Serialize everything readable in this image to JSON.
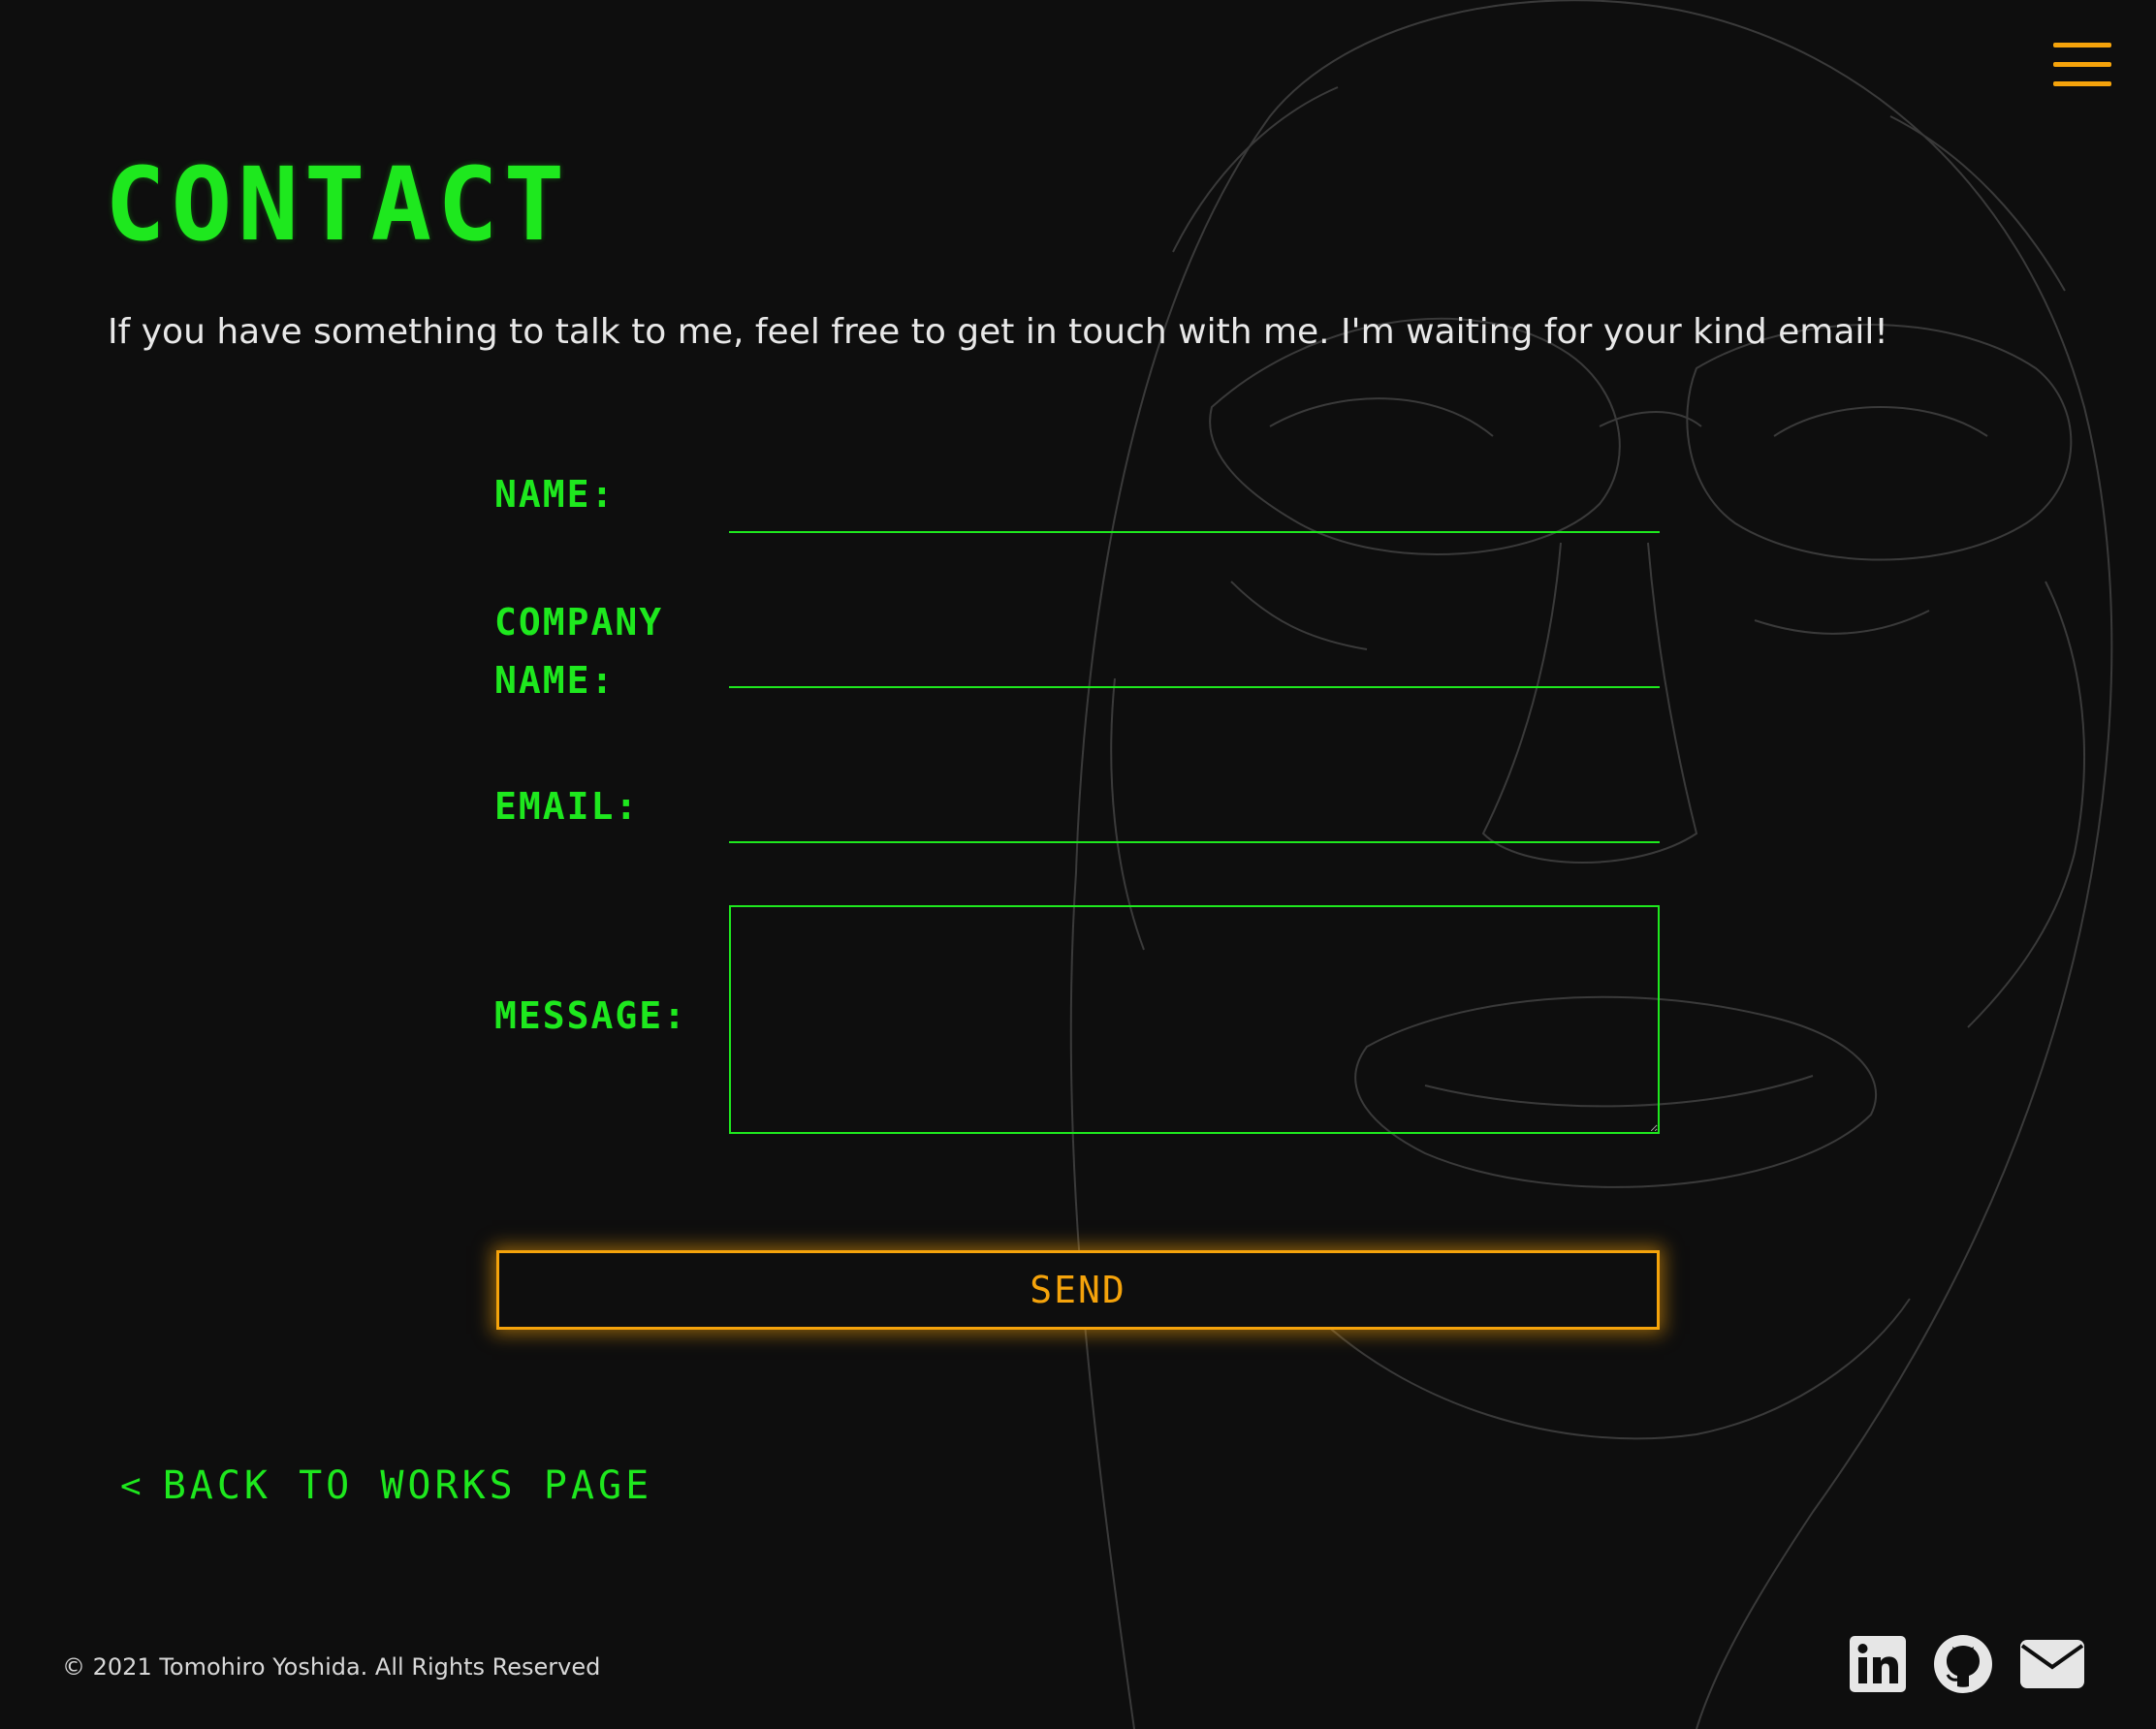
{
  "header": {
    "menu_icon": "hamburger-menu-icon",
    "accent_color": "#f5a30b"
  },
  "page": {
    "title": "CONTACT",
    "intro": "If you have something to talk to me, feel free to get in touch with me. I'm waiting for your kind email!",
    "primary_color": "#1ee81e"
  },
  "form": {
    "name_label": "NAME:",
    "name_value": "",
    "company_label_line1": "COMPANY",
    "company_label_line2": "NAME:",
    "company_value": "",
    "email_label": "EMAIL:",
    "email_value": "",
    "message_label": "MESSAGE:",
    "message_value": "",
    "send_label": "SEND"
  },
  "navigation": {
    "back_label": "BACK TO WORKS PAGE",
    "back_icon": "chevron-left-icon"
  },
  "footer": {
    "copyright": "© 2021 Tomohiro Yoshida. All Rights Reserved",
    "social_icons": [
      "linkedin-icon",
      "github-icon",
      "envelope-icon"
    ]
  }
}
